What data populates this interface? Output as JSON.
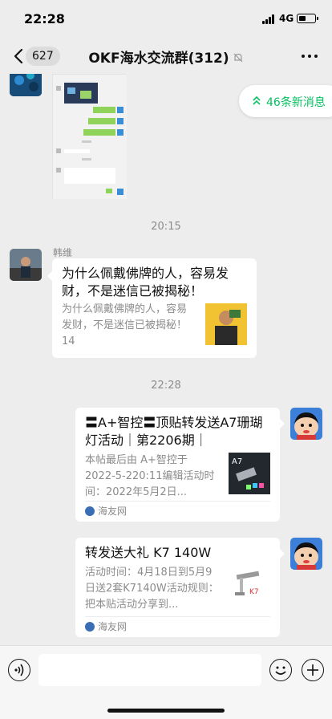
{
  "status_bar": {
    "time": "22:28",
    "network": "4G"
  },
  "nav": {
    "back_count": "627",
    "title": "OKF海水交流群(312)"
  },
  "new_messages": {
    "label": "46条新消息"
  },
  "timestamps": [
    "20:15",
    "22:28"
  ],
  "messages": [
    {
      "sender": "韩维",
      "title": "为什么佩戴佛牌的人，容易发财，不是迷信已被揭秘！",
      "desc": "为什么佩戴佛牌的人，容易发财，不是迷信已被揭秘！14"
    },
    {
      "title": "〓A+智控〓顶贴转发送A7珊瑚灯活动｜第2206期｜",
      "desc": "本帖最后由 A+智控于 2022-5-220:11编辑活动时间：2022年5月2日...",
      "source": "海友网"
    },
    {
      "title": "转发送大礼 K7 140W",
      "desc": "活动时间：4月18日到5月9日送2套K7140W活动规则：把本贴活动分享到...",
      "source": "海友网"
    }
  ],
  "colors": {
    "accent": "#07c160",
    "background": "#ededed",
    "bubble": "#ffffff"
  }
}
